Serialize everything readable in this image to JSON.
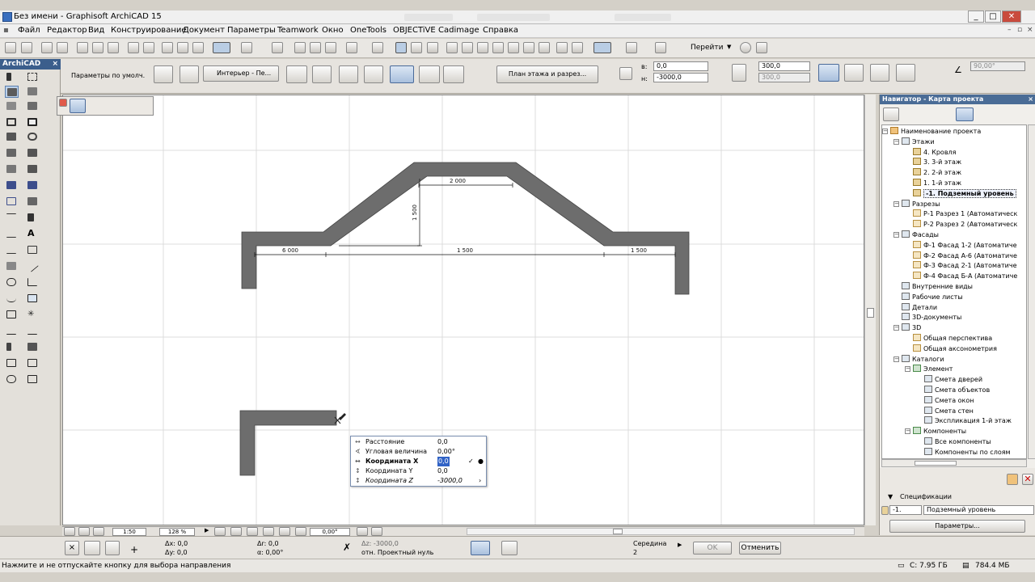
{
  "window": {
    "title": "Без имени - Graphisoft ArchiCAD 15"
  },
  "menu": [
    "Файл",
    "Редактор",
    "Вид",
    "Конструирование",
    "Документ",
    "Параметры",
    "Teamwork",
    "Окно",
    "OneTools",
    "OBJECTiVE",
    "Cadimage",
    "Справка"
  ],
  "toolbar": {
    "goto_label": "Перейти"
  },
  "toolbox": {
    "title": "ArchiCAD"
  },
  "infobox": {
    "favorites_label": "Параметры по умолч.",
    "render_label": "Интерьер - Пе...",
    "floorplan_button": "План этажа и разрез...",
    "top_value": "0,0",
    "bottom_value": "-3000,0",
    "top_key": "в:",
    "bottom_key": "н:",
    "height_value": "300,0",
    "height_value2": "300,0",
    "angle_value": "90,00°"
  },
  "drawing": {
    "dims": [
      "2 000",
      "1 500",
      "6 000",
      "1 500",
      "1 500"
    ]
  },
  "tracker": {
    "rows": [
      {
        "icon": "↔",
        "label": "Расстояние",
        "value": "0,0"
      },
      {
        "icon": "∢",
        "label": "Угловая величина",
        "value": "0,00°"
      },
      {
        "icon": "↔",
        "label": "Координата X",
        "value": "0,0"
      },
      {
        "icon": "↕",
        "label": "Координата Y",
        "value": "0,0"
      },
      {
        "icon": "↕",
        "label": "Координата Z",
        "value": "-3000,0"
      }
    ]
  },
  "navigator": {
    "title": "Навигатор - Карта проекта",
    "tree": [
      {
        "label": "Наименование проекта",
        "level": 0,
        "icon": "fold"
      },
      {
        "label": "Этажи",
        "level": 1,
        "icon": "list"
      },
      {
        "label": "4. Кровля",
        "level": 2,
        "icon": "story"
      },
      {
        "label": "3. 3-й этаж",
        "level": 2,
        "icon": "story"
      },
      {
        "label": "2. 2-й этаж",
        "level": 2,
        "icon": "story"
      },
      {
        "label": "1. 1-й этаж",
        "level": 2,
        "icon": "story"
      },
      {
        "label": "-1. Подземный уровень",
        "level": 2,
        "icon": "story",
        "selected": true
      },
      {
        "label": "Разрезы",
        "level": 1,
        "icon": "list"
      },
      {
        "label": "Р-1 Разрез 1 (Автоматическ",
        "level": 2,
        "icon": "sec"
      },
      {
        "label": "Р-2 Разрез 2 (Автоматическ",
        "level": 2,
        "icon": "sec"
      },
      {
        "label": "Фасады",
        "level": 1,
        "icon": "list"
      },
      {
        "label": "Ф-1 Фасад 1-2 (Автоматиче",
        "level": 2,
        "icon": "sec"
      },
      {
        "label": "Ф-2 Фасад А-6 (Автоматиче",
        "level": 2,
        "icon": "sec"
      },
      {
        "label": "Ф-3 Фасад 2-1 (Автоматиче",
        "level": 2,
        "icon": "sec"
      },
      {
        "label": "Ф-4 Фасад Б-А (Автоматиче",
        "level": 2,
        "icon": "sec"
      },
      {
        "label": "Внутренние виды",
        "level": 1,
        "icon": "list"
      },
      {
        "label": "Рабочие листы",
        "level": 1,
        "icon": "list"
      },
      {
        "label": "Детали",
        "level": 1,
        "icon": "list"
      },
      {
        "label": "3D-документы",
        "level": 1,
        "icon": "list"
      },
      {
        "label": "3D",
        "level": 1,
        "icon": "list"
      },
      {
        "label": "Общая перспектива",
        "level": 2,
        "icon": "sec"
      },
      {
        "label": "Общая аксонометрия",
        "level": 2,
        "icon": "sec"
      },
      {
        "label": "Каталоги",
        "level": 1,
        "icon": "list"
      },
      {
        "label": "Элемент",
        "level": 2,
        "icon": "cat"
      },
      {
        "label": "Смета дверей",
        "level": 3,
        "icon": "list"
      },
      {
        "label": "Смета объектов",
        "level": 3,
        "icon": "list"
      },
      {
        "label": "Смета окон",
        "level": 3,
        "icon": "list"
      },
      {
        "label": "Смета стен",
        "level": 3,
        "icon": "list"
      },
      {
        "label": "Экспликация 1-й этаж",
        "level": 3,
        "icon": "list"
      },
      {
        "label": "Компоненты",
        "level": 2,
        "icon": "cat"
      },
      {
        "label": "Все компоненты",
        "level": 3,
        "icon": "list"
      },
      {
        "label": "Компоненты по слоям",
        "level": 3,
        "icon": "list"
      }
    ],
    "spec_label": "Спецификации",
    "spec_id": "-1.",
    "spec_name": "Подземный уровень",
    "params_button": "Параметры..."
  },
  "bottombar": {
    "scale": "1:50",
    "zoom": "128 %",
    "angle": "0,00°"
  },
  "coords": {
    "dx": "Δx: 0,0",
    "dy": "Δy: 0,0",
    "dr": "Δr: 0,0",
    "da": "α: 0,00°",
    "dz": "Δz: -3000,0",
    "ref": "отн. Проектный нуль",
    "snap_label": "Середина",
    "snap_value": "2",
    "ok": "OK",
    "cancel": "Отменить"
  },
  "status": {
    "message": "Нажмите и не отпускайте кнопку для выбора направления",
    "disk": "С: 7.95 ГБ",
    "memory": "784.4 МБ"
  },
  "colors": {
    "wall": "#6d6d6d",
    "accent": "#3b5e8c",
    "selection": "#bcd1ea"
  }
}
